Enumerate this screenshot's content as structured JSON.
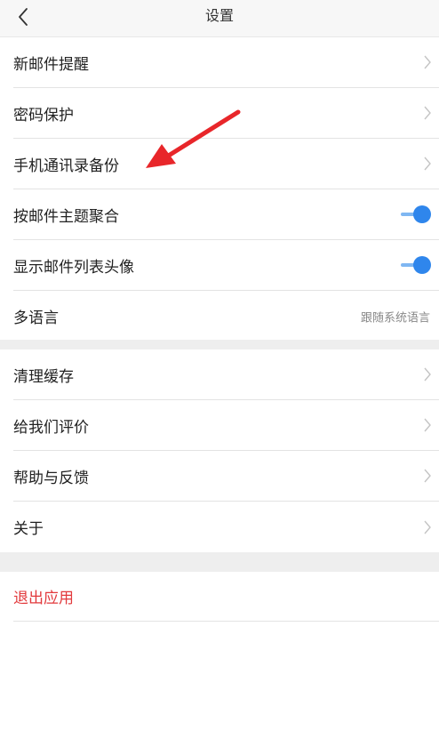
{
  "header": {
    "title": "设置"
  },
  "group1": {
    "items": [
      {
        "label": "新邮件提醒",
        "type": "link"
      },
      {
        "label": "密码保护",
        "type": "link"
      },
      {
        "label": "手机通讯录备份",
        "type": "link"
      },
      {
        "label": "按邮件主题聚合",
        "type": "toggle",
        "enabled": true
      },
      {
        "label": "显示邮件列表头像",
        "type": "toggle",
        "enabled": true
      },
      {
        "label": "多语言",
        "type": "value",
        "value": "跟随系统语言"
      }
    ]
  },
  "group2": {
    "items": [
      {
        "label": "清理缓存",
        "type": "link"
      },
      {
        "label": "给我们评价",
        "type": "link"
      },
      {
        "label": "帮助与反馈",
        "type": "link"
      },
      {
        "label": "关于",
        "type": "link"
      }
    ]
  },
  "logout": {
    "label": "退出应用"
  },
  "colors": {
    "accent": "#2f86ec",
    "danger": "#e2393c",
    "annotation": "#e8262a"
  },
  "icons": {
    "back": "chevron-left-icon",
    "row_arrow": "chevron-right-icon"
  }
}
